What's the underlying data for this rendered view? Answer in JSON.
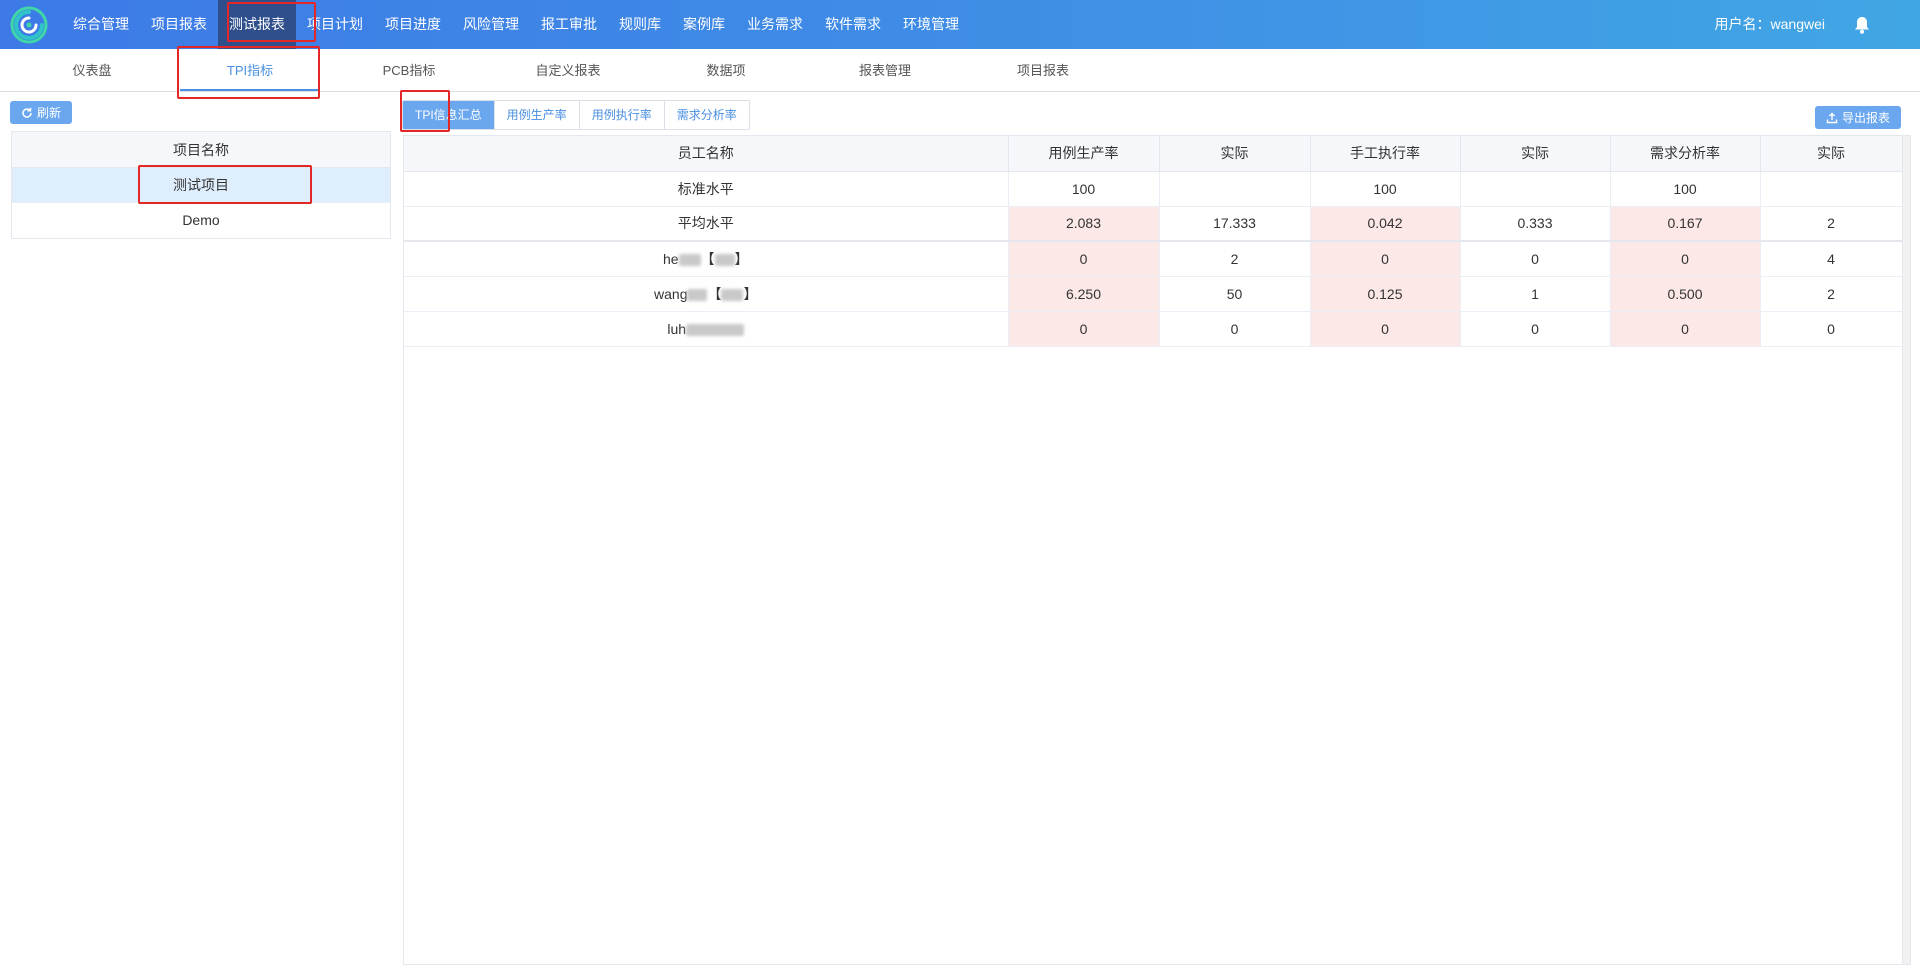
{
  "nav": {
    "items": [
      "综合管理",
      "项目报表",
      "测试报表",
      "项目计划",
      "项目进度",
      "风险管理",
      "报工审批",
      "规则库",
      "案例库",
      "业务需求",
      "软件需求",
      "环境管理"
    ],
    "active_index": 2,
    "user_label": "用户名：",
    "user_name": "wangwei",
    "bell_icon": "bell-icon"
  },
  "subnav": {
    "items": [
      "仪表盘",
      "TPI指标",
      "PCB指标",
      "自定义报表",
      "数据项",
      "报表管理",
      "项目报表"
    ],
    "active_index": 1
  },
  "left": {
    "refresh_label": "刷新",
    "refresh_icon": "refresh-icon",
    "header": "项目名称",
    "projects": [
      "测试项目",
      "Demo"
    ],
    "selected_index": 0
  },
  "right": {
    "tabs": [
      "TPI信息汇总",
      "用例生产率",
      "用例执行率",
      "需求分析率"
    ],
    "active_tab": 0,
    "export_label": "导出报表",
    "export_icon": "upload-icon",
    "columns": [
      "员工名称",
      "用例生产率",
      "实际",
      "手工执行率",
      "实际",
      "需求分析率",
      "实际"
    ],
    "rows": [
      {
        "name": "标准水平",
        "values": [
          "100",
          "",
          "100",
          "",
          "100",
          ""
        ]
      },
      {
        "name": "平均水平",
        "values": [
          "2.083",
          "17.333",
          "0.042",
          "0.333",
          "0.167",
          "2"
        ]
      },
      {
        "name_prefix": "he",
        "name_suffix": "【",
        "name_end": "】",
        "values": [
          "0",
          "2",
          "0",
          "0",
          "0",
          "4"
        ]
      },
      {
        "name_prefix": "wang",
        "name_suffix": "【",
        "name_end": "】",
        "values": [
          "6.250",
          "50",
          "0.125",
          "1",
          "0.500",
          "2"
        ]
      },
      {
        "name_prefix": "luh",
        "name_suffix": "",
        "name_end": "",
        "values": [
          "0",
          "0",
          "0",
          "0",
          "0",
          "0"
        ]
      }
    ]
  },
  "colors": {
    "topbar_start": "#3d7ae6",
    "topbar_end": "#41a6e4",
    "active_nav": "#2f4f8c",
    "accent": "#4a8fe0",
    "button": "#6aa7ee",
    "pink_cell": "#fde8e8",
    "highlight_box": "#e32626"
  }
}
